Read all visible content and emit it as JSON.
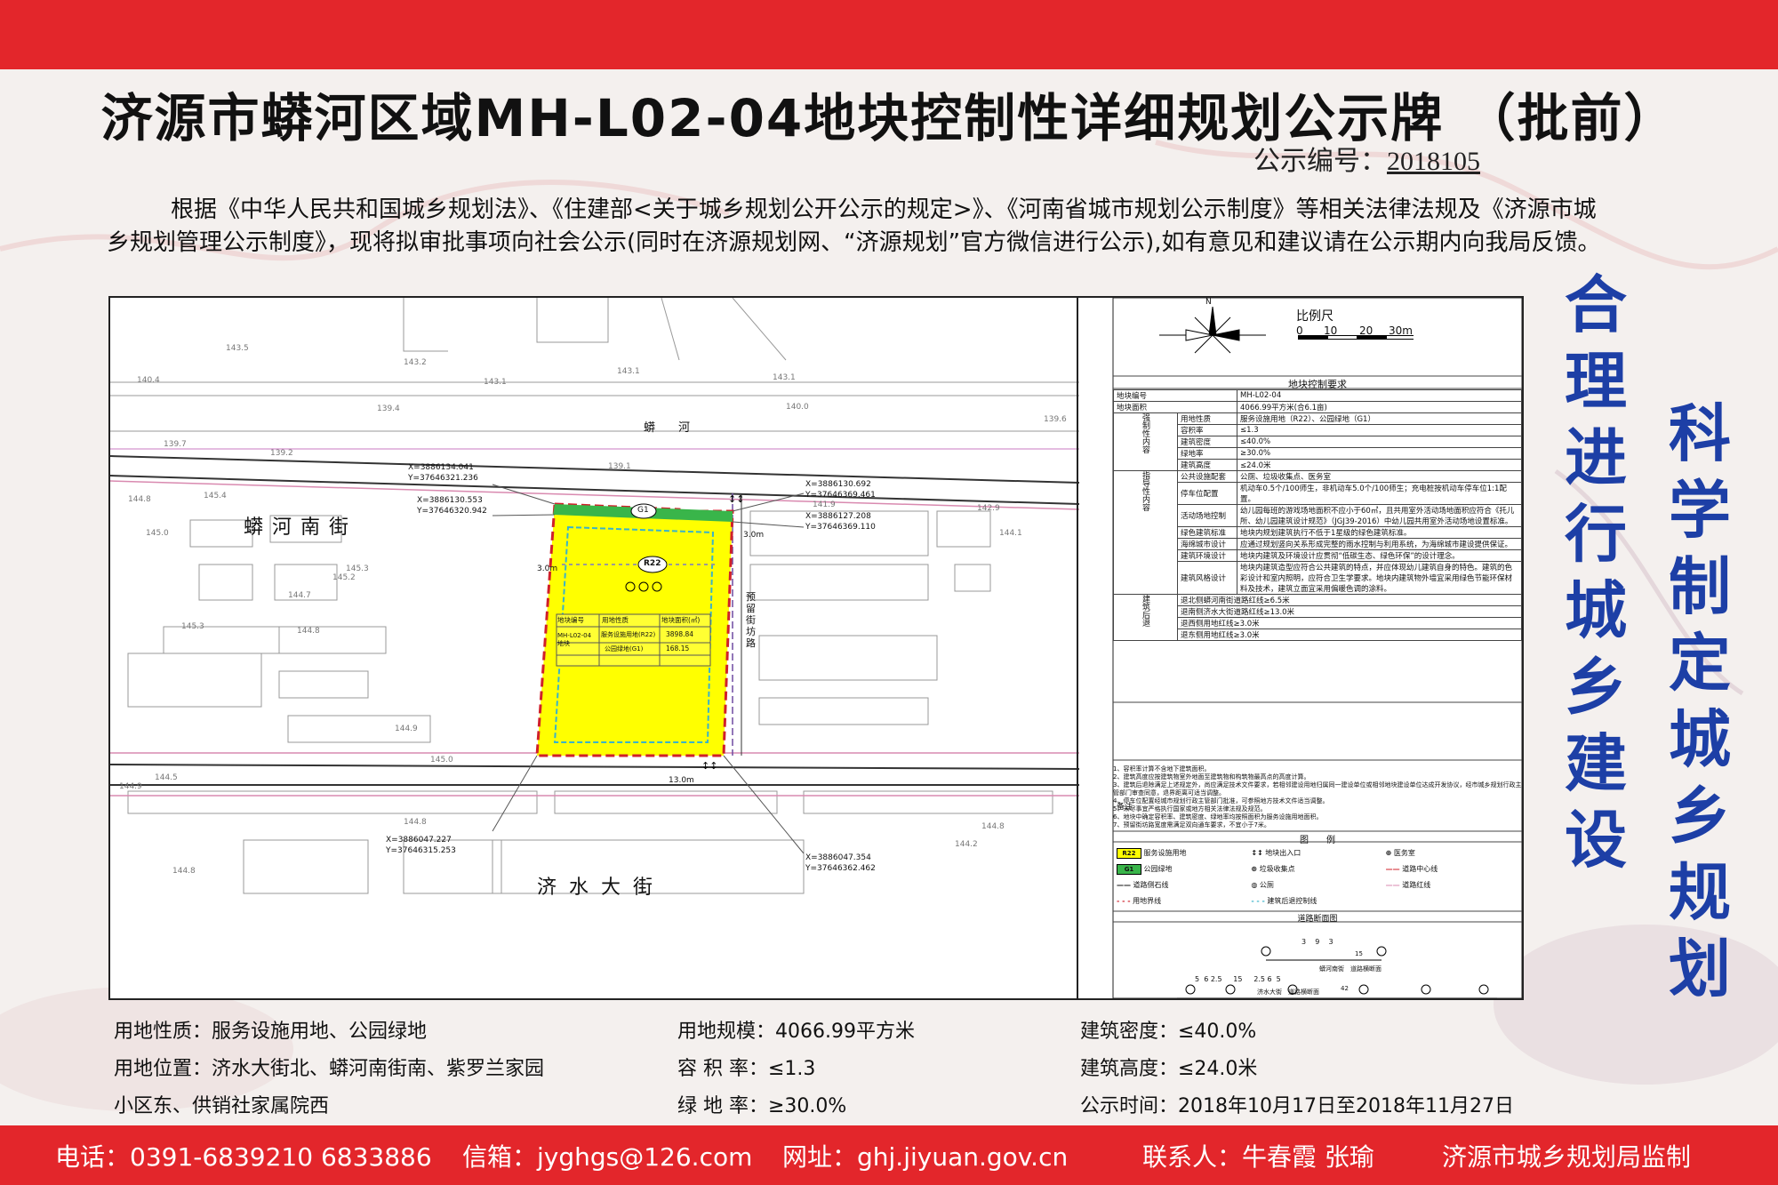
{
  "title": "济源市蟒河区域MH-L02-04地块控制性详细规划公示牌 （批前）",
  "pub_no": {
    "label": "公示编号：",
    "value": "2018105"
  },
  "intro": "根据《中华人民共和国城乡规划法》、《住建部<关于城乡规划公开公示的规定>》、《河南省城市规划公示制度》等相关法律法规及《济源市城乡规划管理公示制度》，现将拟审批事项向社会公示(同时在济源规划网、“济源规划”官方微信进行公示),如有意见和建议请在公示期内向我局反馈。",
  "slogans": {
    "left": "合理进行城乡建设",
    "right": "科学制定城乡规划"
  },
  "map": {
    "roads": {
      "north": "蟒河南街",
      "south": "济水大街",
      "river": "蟒　　河",
      "side": "预留街坊路"
    },
    "coords": [
      {
        "x": "X=3886134.041",
        "y": "Y=37646321.236"
      },
      {
        "x": "X=3886130.553",
        "y": "Y=37646320.942"
      },
      {
        "x": "X=3886130.692",
        "y": "Y=37646369.461"
      },
      {
        "x": "X=3886127.208",
        "y": "Y=37646369.110"
      },
      {
        "x": "X=3886047.227",
        "y": "Y=37646315.253"
      },
      {
        "x": "X=3886047.354",
        "y": "Y=37646362.462"
      }
    ],
    "labels": {
      "g1": "G1",
      "r22": "R22",
      "dim1": "3.0m",
      "dim2": "3.0m",
      "dim3": "13.0m"
    },
    "elevations": [
      "143.5",
      "143.2",
      "143.1",
      "143.1",
      "143.1",
      "140.4",
      "139.4",
      "140.0",
      "139.6",
      "139.7",
      "139.2",
      "139.1",
      "144.8",
      "145.4",
      "141.9",
      "142.9",
      "144.1",
      "145.0",
      "145.3",
      "145.2",
      "144.7",
      "145.3",
      "144.8",
      "144.9",
      "145.0",
      "144.5",
      "144.9",
      "144.8",
      "144.8",
      "144.2",
      "144.8"
    ],
    "inner_table": {
      "headers": [
        "地块编号",
        "用地性质",
        "地块面积(㎡)"
      ],
      "block": "MH-L02-04 地块",
      "rows": [
        [
          "服务设施用地(R22)",
          "3898.84"
        ],
        [
          "公园绿地(G1)",
          "168.15"
        ]
      ]
    }
  },
  "legend_panel": {
    "scale_title": "比例尺",
    "scale_ticks": [
      "0",
      "10",
      "20",
      "30m"
    ],
    "north": "N",
    "control_title": "地块控制要求",
    "basic": [
      [
        "地块编号",
        "MH-L02-04"
      ],
      [
        "地块面积",
        "4066.99平方米(合6.1亩)"
      ]
    ],
    "mandatory_label": "强制性内容",
    "mandatory": [
      [
        "用地性质",
        "服务设施用地（R22）、公园绿地（G1）"
      ],
      [
        "容积率",
        "≤1.3"
      ],
      [
        "建筑密度",
        "≤40.0%"
      ],
      [
        "绿地率",
        "≥30.0%"
      ],
      [
        "建筑高度",
        "≤24.0米"
      ]
    ],
    "guide_label": "指导性内容",
    "guide": [
      [
        "公共设施配套",
        "公厕、垃圾收集点、医务室"
      ],
      [
        "停车位配置",
        "机动车0.5个/100师生，非机动车5.0个/100师生；充电桩按机动车停车位1:1配置。"
      ],
      [
        "活动场地控制",
        "幼儿园每班的游戏场地面积不应小于60㎡，且共用室外活动场地面积应符合《托儿所、幼儿园建筑设计规范》（JGJ39-2016）中幼儿园共用室外活动场地设置标准。"
      ],
      [
        "绿色建筑标准",
        "地块内规划建筑执行不低于1星级的绿色建筑标准。"
      ],
      [
        "海绵城市设计",
        "应通过规划竖向关系形成完整的雨水控制与利用系统，为海绵城市建设提供保证。"
      ],
      [
        "建筑环境设计",
        "地块内建筑及环境设计应贯彻“低碳生态、绿色环保”的设计理念。"
      ],
      [
        "建筑风格设计",
        "地块内建筑造型应符合公共建筑的特点，并应体现幼儿建筑自身的特色。建筑的色彩设计和室内照明，应符合卫生学要求。地块内建筑物外墙宜采用绿色节能环保材料及技术，建筑立面宜采用偏暖色调的涂料。"
      ]
    ],
    "setback_label": "建筑后退",
    "setback": [
      "退北侧蟒河南街道路红线≥6.5米",
      "退南侧济水大街道路红线≥13.0米",
      "退西侧用地红线≥3.0米",
      "退东侧用地红线≥3.0米"
    ],
    "notes_label": "备注",
    "notes": [
      "1、容积率计算不含地下建筑面积。",
      "2、建筑高度应按建筑物室外地面至建筑物和构筑物最高点的高度计算。",
      "3、建筑后退除满足上述规定外，尚应满足技术文件要求，若相邻建设用地归属同一建设单位或相邻地块建设单位达成开发协议，经市城乡规划行政主管部门审查同意，退界距离可适当调整。",
      "4、停车位配置经城市规划行政主管部门批准，可参照地方技术文件适当调整。",
      "5、未尽事宜严格执行国家或地方相关法律法规及规范。",
      "6、地块中确定容积率、建筑密度、绿地率均按照面积为服务设施用地面积。",
      "7、预留街坊路宽度需满足双向通车要求，不宜小于7米。"
    ],
    "legend_title": "图　　例",
    "legend": [
      {
        "sym": "R22",
        "label": "服务设施用地"
      },
      {
        "sym": "entrance",
        "label": "地块出入口"
      },
      {
        "sym": "clinic",
        "label": "医务室"
      },
      {
        "sym": "G1",
        "label": "公园绿地"
      },
      {
        "sym": "trash",
        "label": "垃圾收集点"
      },
      {
        "sym": "centerline",
        "label": "道路中心线"
      },
      {
        "sym": "curb",
        "label": "道路侧石线"
      },
      {
        "sym": "toilet",
        "label": "公厕"
      },
      {
        "sym": "redline",
        "label": "道路红线"
      },
      {
        "sym": "boundary",
        "label": "用地界线"
      },
      {
        "sym": "setback",
        "label": "建筑后退控制线"
      }
    ],
    "section_title": "道路断面图",
    "section1": {
      "dims": [
        "3",
        "9",
        "3"
      ],
      "total": "15",
      "name": "蟒河南街　道路横断面"
    },
    "section2": {
      "dims": [
        "5",
        "6",
        "2.5",
        "15",
        "2.5",
        "6",
        "5"
      ],
      "total": "42",
      "name": "济水大街　道路横断面"
    }
  },
  "bottom": {
    "col1": [
      "用地性质：服务设施用地、公园绿地",
      "用地位置：济水大街北、蟒河南街南、紫罗兰家园",
      "小区东、供销社家属院西"
    ],
    "col2": [
      "用地规模：4066.99平方米",
      "容 积 率：≤1.3",
      "绿 地 率：≥30.0%"
    ],
    "col3": [
      "建筑密度：≤40.0%",
      "建筑高度：≤24.0米",
      "公示时间：2018年10月17日至2018年11月27日"
    ]
  },
  "footer": {
    "phone": "电话：0391-6839210 6833886",
    "email": "信箱：jyghgs@126.com",
    "web": "网址：ghj.jiyuan.gov.cn",
    "contact": "联系人：牛春霞 张瑜",
    "supervisor": "济源市城乡规划局监制"
  },
  "colors": {
    "red": "#e3262b",
    "slogan": "#1d3fa6",
    "yellow": "#ffff00",
    "green": "#39b54a"
  }
}
